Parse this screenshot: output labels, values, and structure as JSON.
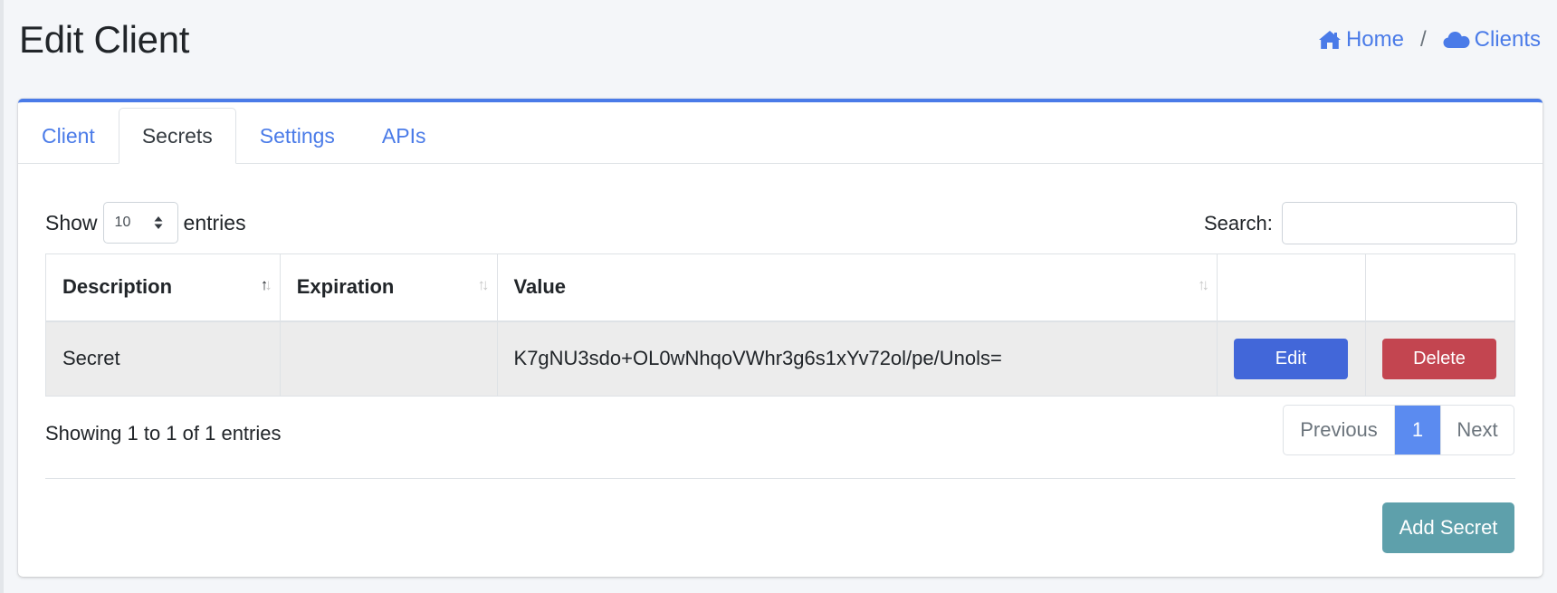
{
  "page": {
    "title": "Edit Client"
  },
  "breadcrumb": {
    "home": "Home",
    "separator": "/",
    "clients": "Clients"
  },
  "tabs": [
    {
      "label": "Client",
      "active": false
    },
    {
      "label": "Secrets",
      "active": true
    },
    {
      "label": "Settings",
      "active": false
    },
    {
      "label": "APIs",
      "active": false
    }
  ],
  "length_control": {
    "show": "Show",
    "value": "10",
    "entries": "entries"
  },
  "search": {
    "label": "Search:",
    "value": ""
  },
  "table": {
    "headers": [
      "Description",
      "Expiration",
      "Value",
      "",
      ""
    ],
    "sorted_column": "Description",
    "rows": [
      {
        "description": "Secret",
        "expiration": "",
        "value": "K7gNU3sdo+OL0wNhqoVWhr3g6s1xYv72ol/pe/Unols=",
        "edit": "Edit",
        "delete": "Delete"
      }
    ]
  },
  "info": "Showing 1 to 1 of 1 entries",
  "pagination": {
    "previous": "Previous",
    "current": "1",
    "next": "Next"
  },
  "actions": {
    "add_secret": "Add Secret"
  },
  "colors": {
    "accent": "#4a7be8",
    "edit": "#4267d9",
    "delete": "#c34550",
    "add": "#5ea0ab"
  }
}
